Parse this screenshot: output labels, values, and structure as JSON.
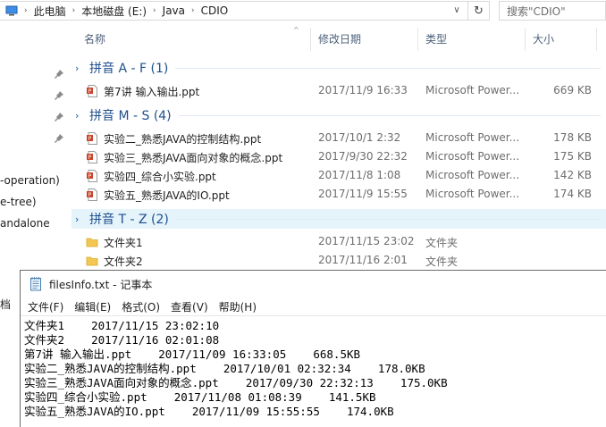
{
  "explorer": {
    "breadcrumb": [
      "此电脑",
      "本地磁盘 (E:)",
      "Java",
      "CDIO"
    ],
    "search_placeholder": "搜索\"CDIO\"",
    "columns": {
      "name": "名称",
      "date": "修改日期",
      "type": "类型",
      "size": "大小"
    },
    "nav_items": [
      "-operation)",
      "e-tree)",
      "andalone"
    ],
    "groups": [
      {
        "title": "拼音 A - F (1)",
        "highlighted": false,
        "files": [
          {
            "name": "第7讲 输入输出.ppt",
            "date": "2017/11/9 16:33",
            "type": "Microsoft Power...",
            "size": "669 KB",
            "icon": "ppt-file-icon"
          }
        ]
      },
      {
        "title": "拼音 M - S (4)",
        "highlighted": false,
        "files": [
          {
            "name": "实验二_熟悉JAVA的控制结构.ppt",
            "date": "2017/10/1 2:32",
            "type": "Microsoft Power...",
            "size": "178 KB",
            "icon": "ppt-file-icon"
          },
          {
            "name": "实验三_熟悉JAVA面向对象的概念.ppt",
            "date": "2017/9/30 22:32",
            "type": "Microsoft Power...",
            "size": "175 KB",
            "icon": "ppt-file-icon"
          },
          {
            "name": "实验四_综合小实验.ppt",
            "date": "2017/11/8 1:08",
            "type": "Microsoft Power...",
            "size": "142 KB",
            "icon": "ppt-file-icon"
          },
          {
            "name": "实验五_熟悉JAVA的IO.ppt",
            "date": "2017/11/9 15:55",
            "type": "Microsoft Power...",
            "size": "174 KB",
            "icon": "ppt-file-icon"
          }
        ]
      },
      {
        "title": "拼音 T - Z (2)",
        "highlighted": true,
        "files": [
          {
            "name": "文件夹1",
            "date": "2017/11/15 23:02",
            "type": "文件夹",
            "size": "",
            "icon": "folder-icon"
          },
          {
            "name": "文件夹2",
            "date": "2017/11/16 2:01",
            "type": "文件夹",
            "size": "",
            "icon": "folder-icon"
          }
        ]
      }
    ]
  },
  "left_strip_label": "档",
  "notepad": {
    "title": "filesInfo.txt - 记事本",
    "menu": [
      "文件(F)",
      "编辑(E)",
      "格式(O)",
      "查看(V)",
      "帮助(H)"
    ],
    "lines": [
      "文件夹1    2017/11/15 23:02:10",
      "文件夹2    2017/11/16 02:01:08",
      "第7讲 输入输出.ppt    2017/11/09 16:33:05    668.5KB",
      "实验二_熟悉JAVA的控制结构.ppt    2017/10/01 02:32:34    178.0KB",
      "实验三_熟悉JAVA面向对象的概念.ppt    2017/09/30 22:32:13    175.0KB",
      "实验四_综合小实验.ppt    2017/11/08 01:08:39    141.5KB",
      "实验五_熟悉JAVA的IO.ppt    2017/11/09 15:55:55    174.0KB"
    ]
  },
  "colors": {
    "group_title": "#1e4e8c",
    "group_highlight": "#e5f3fb",
    "column_header": "#4c607a",
    "secondary_text": "#6d6d6d"
  }
}
